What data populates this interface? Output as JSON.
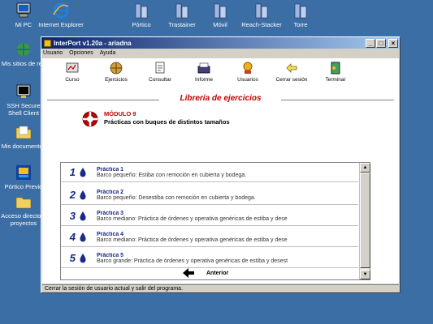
{
  "desktop": {
    "left_icons": [
      {
        "label": "Mi PC",
        "icon": "computer-icon"
      },
      {
        "label": "Mis sitios de red",
        "icon": "network-places-icon"
      },
      {
        "label": "SSH Secure Shell Client",
        "icon": "ssh-client-icon"
      },
      {
        "label": "Mis documentos",
        "icon": "folder-icon"
      },
      {
        "label": "Pórtico Previo",
        "icon": "app-icon"
      },
      {
        "label": "Acceso directo a proyectos",
        "icon": "folder-icon"
      }
    ],
    "top_icons": [
      {
        "label": "Internet Explorer",
        "icon": "ie-icon"
      },
      {
        "label": "Pórtico",
        "icon": "building-icon"
      },
      {
        "label": "Trastainer",
        "icon": "building-icon"
      },
      {
        "label": "Móvil",
        "icon": "building-icon"
      },
      {
        "label": "Reach-Stacker",
        "icon": "building-icon"
      },
      {
        "label": "Torre",
        "icon": "building-icon"
      }
    ]
  },
  "window": {
    "title": "InterPort v1.20a - ariadna",
    "controls": {
      "minimize": "_",
      "maximize": "□",
      "close": "×"
    },
    "menu": [
      "Usuario",
      "Opciones",
      "Ayuda"
    ],
    "toolbar": [
      {
        "label": "Curso",
        "icon": "course-icon"
      },
      {
        "label": "Ejercicios",
        "icon": "exercises-icon"
      },
      {
        "label": "Consultar",
        "icon": "consult-icon"
      },
      {
        "label": "Informe",
        "icon": "report-icon"
      },
      {
        "label": "Usuarios",
        "icon": "users-icon"
      },
      {
        "label": "Cerrar sesión",
        "icon": "close-session-icon"
      },
      {
        "label": "Terminar",
        "icon": "exit-icon"
      }
    ],
    "heading": "Librería de ejercicios",
    "module": {
      "title": "MÓDULO 9",
      "subtitle": "Prácticas con buques de distintos tamaños"
    },
    "practices": [
      {
        "num": "1",
        "title": "Práctica 1",
        "desc": "Barco pequeño: Estiba con remoción en cubierta y bodega."
      },
      {
        "num": "2",
        "title": "Práctica 2",
        "desc": "Barco pequeño: Desestiba con remoción en cubierta y bodega."
      },
      {
        "num": "3",
        "title": "Práctica 3",
        "desc": "Barco mediano: Práctica de órdenes y operativa genéricas de estiba y dese"
      },
      {
        "num": "4",
        "title": "Práctica 4",
        "desc": "Barco mediano: Práctica de órdenes y operativa genéricas de estiba y dese"
      },
      {
        "num": "5",
        "title": "Práctica 5",
        "desc": "Barco grande: Práctica de órdenes y operativa genéricas de estiba y desest"
      }
    ],
    "back_label": "Anterior",
    "status": "Cerrar la sesión de usuario actual y salir del programa."
  }
}
